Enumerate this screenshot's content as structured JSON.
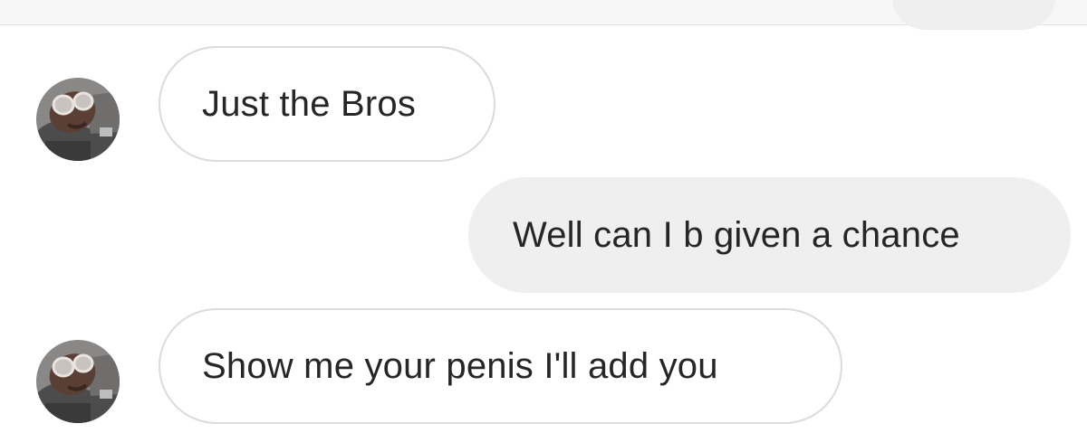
{
  "conversation": {
    "messages": [
      {
        "direction": "incoming",
        "text": "Just the Bros",
        "avatar": "avatar-photo"
      },
      {
        "direction": "outgoing",
        "text": "Well can I b given a chance"
      },
      {
        "direction": "incoming",
        "text": "Show me your penis I'll add you",
        "avatar": "avatar-photo"
      }
    ]
  },
  "colors": {
    "incoming_bubble_bg": "#ffffff",
    "incoming_bubble_border": "#dbdbdb",
    "outgoing_bubble_bg": "#efefef",
    "text": "#262626"
  }
}
